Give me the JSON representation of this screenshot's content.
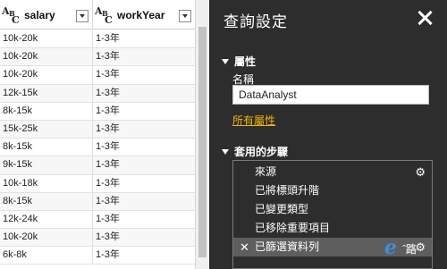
{
  "grid": {
    "columns": [
      {
        "name": "salary",
        "type_icon": "ABC-text-type-icon"
      },
      {
        "name": "workYear",
        "type_icon": "ABC-text-type-icon"
      }
    ],
    "rows": [
      [
        "10k-20k",
        "1-3年"
      ],
      [
        "10k-20k",
        "1-3年"
      ],
      [
        "10k-20k",
        "1-3年"
      ],
      [
        "12k-15k",
        "1-3年"
      ],
      [
        "8k-15k",
        "1-3年"
      ],
      [
        "15k-25k",
        "1-3年"
      ],
      [
        "8k-15k",
        "1-3年"
      ],
      [
        "9k-15k",
        "1-3年"
      ],
      [
        "10k-18k",
        "1-3年"
      ],
      [
        "8k-15k",
        "1-3年"
      ],
      [
        "12k-24k",
        "1-3年"
      ],
      [
        "10k-20k",
        "1-3年"
      ],
      [
        "6k-8k",
        "1-3年"
      ]
    ]
  },
  "panel": {
    "title": "查詢設定",
    "properties": {
      "heading": "屬性",
      "name_label": "名稱",
      "name_value": "DataAnalyst",
      "all_properties_link": "所有屬性"
    },
    "applied_steps": {
      "heading": "套用的步驟",
      "items": [
        {
          "label": "來源",
          "has_gear": true,
          "selected": false
        },
        {
          "label": "已將標頭升階",
          "has_gear": false,
          "selected": false
        },
        {
          "label": "已變更類型",
          "has_gear": false,
          "selected": false
        },
        {
          "label": "已移除重要項目",
          "has_gear": false,
          "selected": false
        },
        {
          "label": "已篩選資料列",
          "has_gear": true,
          "selected": true
        }
      ]
    }
  },
  "watermark": {
    "text": "ˆ路"
  },
  "colors": {
    "panel_bg": "#2d2d2d",
    "link": "#f0b400",
    "selected_step": "#5e5e5e"
  }
}
